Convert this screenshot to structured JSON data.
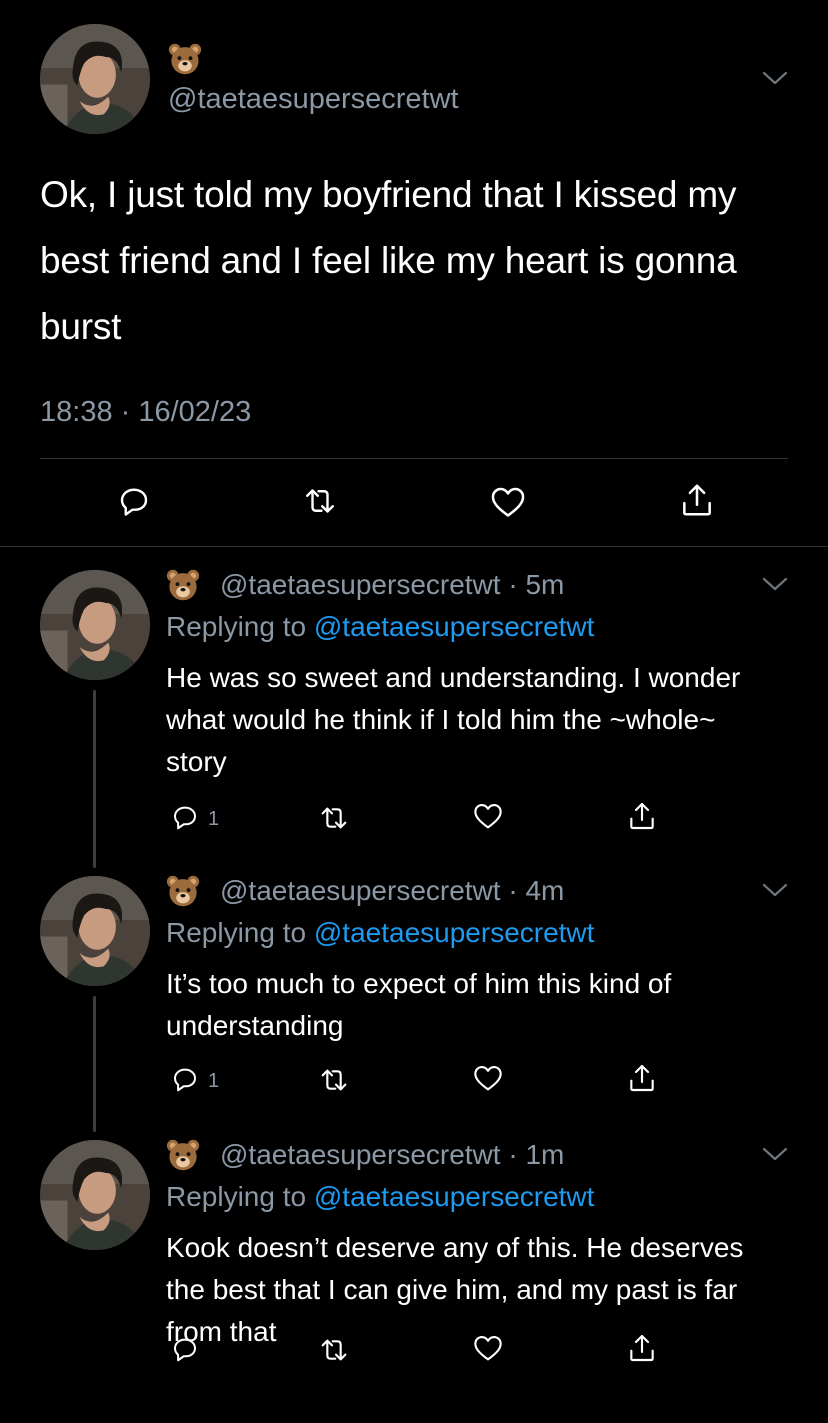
{
  "main_tweet": {
    "emoji": "🐻",
    "handle": "@taetaesupersecretwt",
    "text": "Ok, I just told my boyfriend that I kissed my best friend and I feel like my heart is gonna burst",
    "timestamp": "18:38 · 16/02/23"
  },
  "replies": [
    {
      "emoji": "🐻",
      "handle": "@taetaesupersecretwt",
      "time": "· 5m",
      "replying_prefix": "Replying to",
      "replying_handle": "@taetaesupersecretwt",
      "text": "He was so sweet and understanding. I wonder what would he think if I told him the ~whole~ story",
      "reply_count": "1"
    },
    {
      "emoji": "🐻",
      "handle": "@taetaesupersecretwt",
      "time": "· 4m",
      "replying_prefix": "Replying to",
      "replying_handle": "@taetaesupersecretwt",
      "text": "It’s too much to expect of him this kind of understanding",
      "reply_count": "1"
    },
    {
      "emoji": "🐻",
      "handle": "@taetaesupersecretwt",
      "time": "· 1m",
      "replying_prefix": "Replying to",
      "replying_handle": "@taetaesupersecretwt",
      "text": "Kook doesn’t deserve any of this. He deserves the best that I can give him, and my past is far from that",
      "reply_count": ""
    }
  ],
  "icons": [
    "bear-emoji-icon",
    "chevron-down-icon",
    "reply-icon",
    "retweet-icon",
    "like-icon",
    "share-icon"
  ],
  "colors": {
    "background": "#000000",
    "text": "#ffffff",
    "secondary": "#8b98a5",
    "link": "#1d9bf0",
    "divider": "#2f3336"
  }
}
